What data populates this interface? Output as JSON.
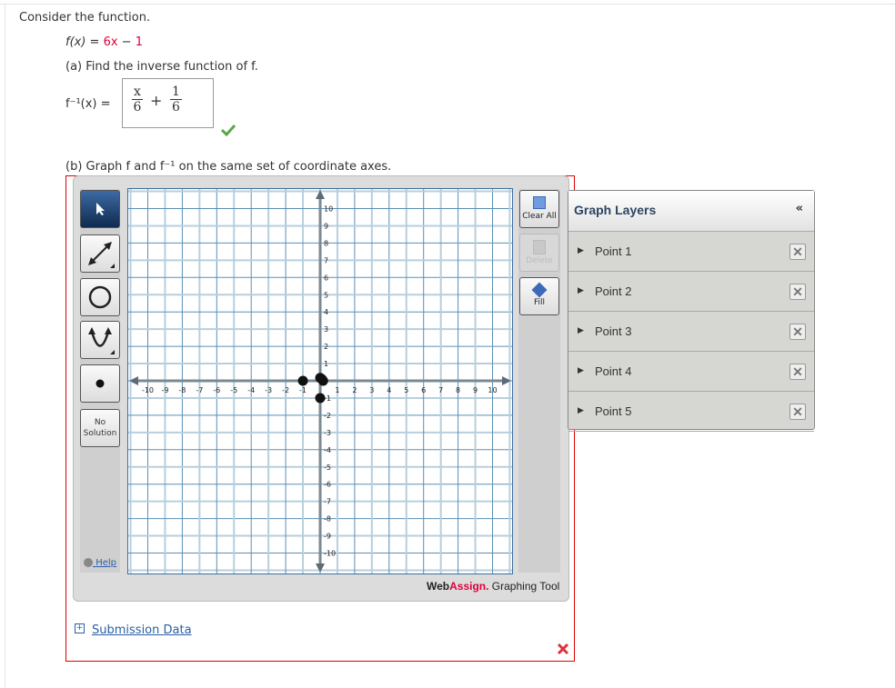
{
  "question": {
    "intro": "Consider the function.",
    "f_lhs": "f(x) = ",
    "f_coef": "6x",
    "f_minus": " − ",
    "f_const": "1",
    "part_a": "(a) Find the inverse function of f.",
    "finv_lhs": "f⁻¹(x) =",
    "answer": {
      "num1": "x",
      "den1": "6",
      "plus": "+",
      "num2": "1",
      "den2": "6"
    },
    "answer_status": "correct",
    "part_b": "(b) Graph f and f⁻¹ on the same set of coordinate axes."
  },
  "tools": {
    "no_solution": "No Solution",
    "help": "Help"
  },
  "right_tools": {
    "clear_all": "Clear All",
    "delete": "Delete",
    "fill": "Fill"
  },
  "brand": {
    "web": "Web",
    "assign": "Assign.",
    "rest": " Graphing Tool",
    "accent": "#e0003c"
  },
  "layers": {
    "title": "Graph Layers",
    "collapse": "«",
    "items": [
      {
        "label": "Point 1"
      },
      {
        "label": "Point 2"
      },
      {
        "label": "Point 3"
      },
      {
        "label": "Point 4"
      },
      {
        "label": "Point 5"
      }
    ]
  },
  "submission": {
    "expand": "+",
    "label": "Submission Data"
  },
  "part_b_status": "incorrect",
  "chart_data": {
    "type": "scatter",
    "xlim": [
      -10,
      10
    ],
    "ylim": [
      -10,
      10
    ],
    "grid": true,
    "x_ticks": [
      -10,
      -9,
      -8,
      -7,
      -6,
      -5,
      -4,
      -3,
      -2,
      -1,
      1,
      2,
      3,
      4,
      5,
      6,
      7,
      8,
      9,
      10
    ],
    "y_ticks": [
      10,
      9,
      8,
      7,
      6,
      5,
      4,
      3,
      2,
      1,
      -1,
      -2,
      -3,
      -4,
      -5,
      -6,
      -7,
      -8,
      -9,
      -10
    ],
    "points": [
      {
        "x": -1,
        "y": 0
      },
      {
        "x": 0,
        "y": 0.17
      },
      {
        "x": 0.17,
        "y": 0
      },
      {
        "x": 0,
        "y": -1
      },
      {
        "x": 0.1,
        "y": 0.1
      }
    ]
  }
}
